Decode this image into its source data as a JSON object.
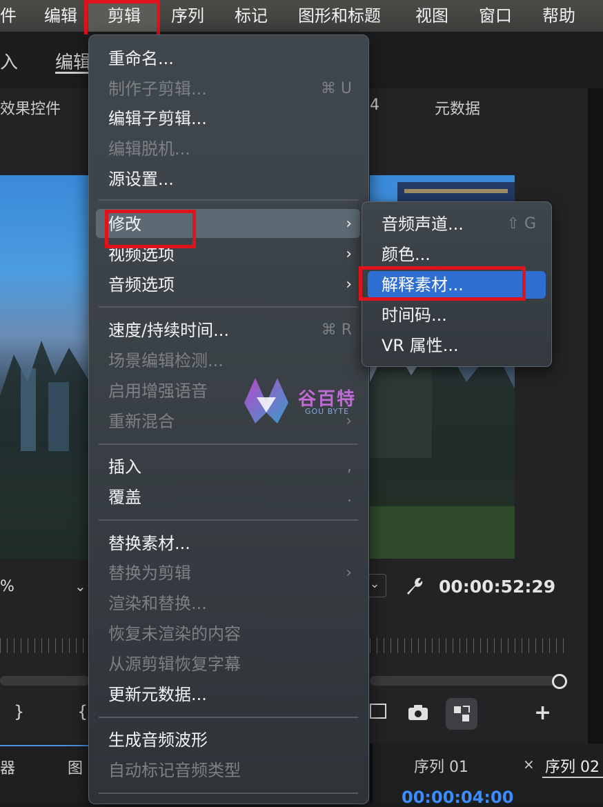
{
  "menubar": {
    "items": [
      "件",
      "编辑",
      "剪辑",
      "序列",
      "标记",
      "图形和标题",
      "视图",
      "窗口",
      "帮助"
    ]
  },
  "workspace": {
    "tabs": [
      "入",
      "编辑"
    ]
  },
  "panels": {
    "left_tab": "效果控件",
    "middle_tab_fragment": "4",
    "right_tab": "元数据"
  },
  "program_monitor": {
    "zoom_fragment": "%",
    "timecode": "00:00:52:29"
  },
  "bottom": {
    "left_tab_fragment_1": "器",
    "left_tab_fragment_2": "图",
    "sequence_tabs": [
      "序列 01",
      "序列 02"
    ],
    "close_symbol": "×",
    "timeline_timecode": "00:00:04:00"
  },
  "clip_menu": {
    "items": [
      {
        "label": "重命名...",
        "enabled": true,
        "shortcut": ""
      },
      {
        "label": "制作子剪辑...",
        "enabled": false,
        "shortcut": "⌘ U"
      },
      {
        "label": "编辑子剪辑...",
        "enabled": true,
        "shortcut": ""
      },
      {
        "label": "编辑脱机...",
        "enabled": false,
        "shortcut": ""
      },
      {
        "label": "源设置...",
        "enabled": true,
        "shortcut": ""
      },
      {
        "label": "修改",
        "enabled": true,
        "submenu": true
      },
      {
        "label": "视频选项",
        "enabled": true,
        "submenu": true
      },
      {
        "label": "音频选项",
        "enabled": true,
        "submenu": true
      },
      {
        "label": "速度/持续时间...",
        "enabled": true,
        "shortcut": "⌘ R"
      },
      {
        "label": "场景编辑检测...",
        "enabled": false,
        "shortcut": ""
      },
      {
        "label": "启用增强语音",
        "enabled": false,
        "shortcut": ""
      },
      {
        "label": "重新混合",
        "enabled": false,
        "submenu": true
      },
      {
        "label": "插入",
        "enabled": true,
        "shortcut": ","
      },
      {
        "label": "覆盖",
        "enabled": true,
        "shortcut": "."
      },
      {
        "label": "替换素材...",
        "enabled": true,
        "shortcut": ""
      },
      {
        "label": "替换为剪辑",
        "enabled": false,
        "submenu": true
      },
      {
        "label": "渲染和替换...",
        "enabled": false,
        "shortcut": ""
      },
      {
        "label": "恢复未渲染的内容",
        "enabled": false,
        "shortcut": ""
      },
      {
        "label": "从源剪辑恢复字幕",
        "enabled": false,
        "shortcut": ""
      },
      {
        "label": "更新元数据...",
        "enabled": true,
        "shortcut": ""
      },
      {
        "label": "生成音频波形",
        "enabled": true,
        "shortcut": ""
      },
      {
        "label": "自动标记音频类型",
        "enabled": false,
        "shortcut": ""
      }
    ]
  },
  "modify_submenu": {
    "items": [
      {
        "label": "音频声道...",
        "shortcut": "⇧ G"
      },
      {
        "label": "颜色...",
        "shortcut": ""
      },
      {
        "label": "解释素材...",
        "shortcut": ""
      },
      {
        "label": "时间码...",
        "shortcut": ""
      },
      {
        "label": "VR 属性...",
        "shortcut": ""
      }
    ]
  },
  "watermark": {
    "title": "谷百特",
    "subtitle": "GOU BYTE"
  },
  "colors": {
    "highlight_red": "#e0121c",
    "submenu_highlight": "#2f6fd1",
    "timecode_blue": "#3b8cff"
  }
}
